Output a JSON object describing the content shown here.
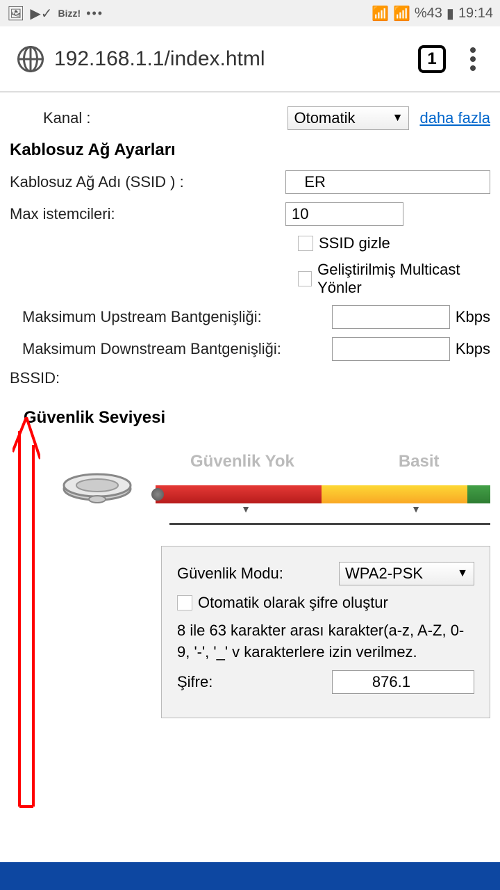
{
  "status": {
    "bizz": "Bizz!",
    "battery_pct": "%43",
    "time": "19:14"
  },
  "browser": {
    "url": "192.168.1.1/index.html",
    "tab_count": "1"
  },
  "channel": {
    "label": "Kanal :",
    "value": "Otomatik",
    "more": "daha fazla"
  },
  "wireless": {
    "section": "Kablosuz Ağ Ayarları",
    "ssid_label": "Kablosuz Ağ Adı (SSID ) :",
    "ssid_value": "   ER",
    "max_clients_label": "Max istemcileri:",
    "max_clients_value": "10",
    "hide_ssid": "SSID gizle",
    "enhanced_multicast": "Geliştirilmiş Multicast Yönler",
    "max_up_label": "Maksimum Upstream Bantgenişliği:",
    "max_down_label": "Maksimum Downstream Bantgenişliği:",
    "kbps": "Kbps",
    "bssid_label": "BSSID:",
    "bssid_value": ""
  },
  "security": {
    "title": "Güvenlik Seviyesi",
    "none": "Güvenlik Yok",
    "basic": "Basit",
    "mode_label": "Güvenlik Modu:",
    "mode_value": "WPA2-PSK",
    "auto_password": "Otomatik olarak şifre oluştur",
    "hint": "8 ile 63 karakter arası karakter(a-z, A-Z, 0-9, '-', '_' v karakterlere izin verilmez.",
    "password_label": "Şifre:",
    "password_value": "        876.1"
  }
}
